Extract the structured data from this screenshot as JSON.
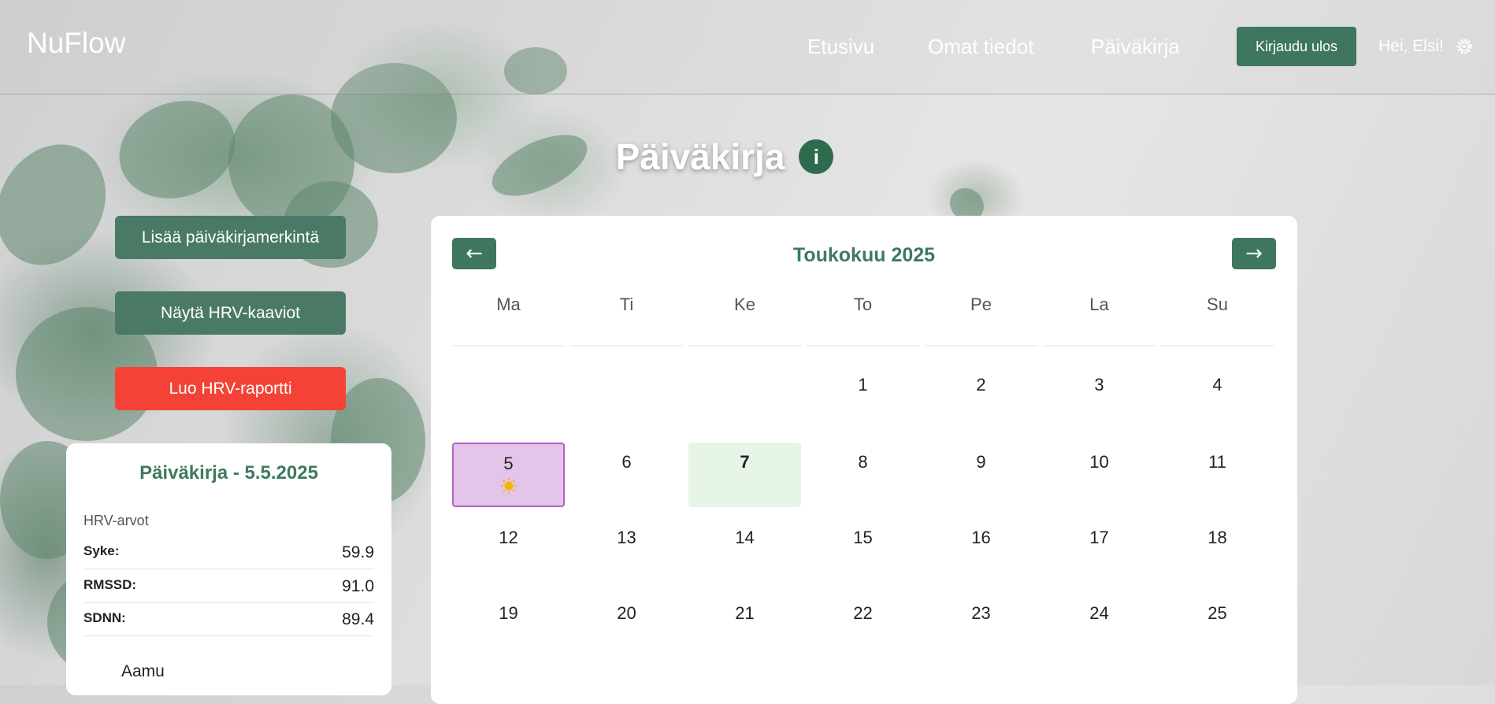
{
  "header": {
    "logo": "NuFlow",
    "nav": [
      "Etusivu",
      "Omat tiedot",
      "Päiväkirja"
    ],
    "logout_label": "Kirjaudu ulos",
    "greeting": "Hei, Elsi!"
  },
  "page": {
    "title": "Päiväkirja",
    "info_label": "i"
  },
  "actions": {
    "add_entry": "Lisää päiväkirjamerkintä",
    "show_charts": "Näytä HRV-kaaviot",
    "create_report": "Luo HRV-raportti"
  },
  "diary": {
    "title": "Päiväkirja - 5.5.2025",
    "hrv_heading": "HRV-arvot",
    "rows": [
      {
        "label": "Syke:",
        "value": "59.9"
      },
      {
        "label": "RMSSD:",
        "value": "91.0"
      },
      {
        "label": "SDNN:",
        "value": "89.4"
      }
    ],
    "section": "Aamu"
  },
  "calendar": {
    "month": "Toukokuu 2025",
    "prev_label": "←",
    "next_label": "→",
    "weekdays": [
      "Ma",
      "Ti",
      "Ke",
      "To",
      "Pe",
      "La",
      "Su"
    ],
    "weeks": [
      [
        "",
        "",
        "",
        "1",
        "2",
        "3",
        "4"
      ],
      [
        "5",
        "6",
        "7",
        "8",
        "9",
        "10",
        "11"
      ],
      [
        "12",
        "13",
        "14",
        "15",
        "16",
        "17",
        "18"
      ],
      [
        "19",
        "20",
        "21",
        "22",
        "23",
        "24",
        "25"
      ]
    ],
    "selected_day": "5",
    "today": "7",
    "marked_day_icon": "sun-icon"
  },
  "colors": {
    "primary": "#3f765f",
    "danger": "#f44336",
    "title_green": "#3e7a5e",
    "selected_bg": "#e3c4ea",
    "selected_border": "#b65fc8",
    "today_bg": "#e6f5e8"
  }
}
